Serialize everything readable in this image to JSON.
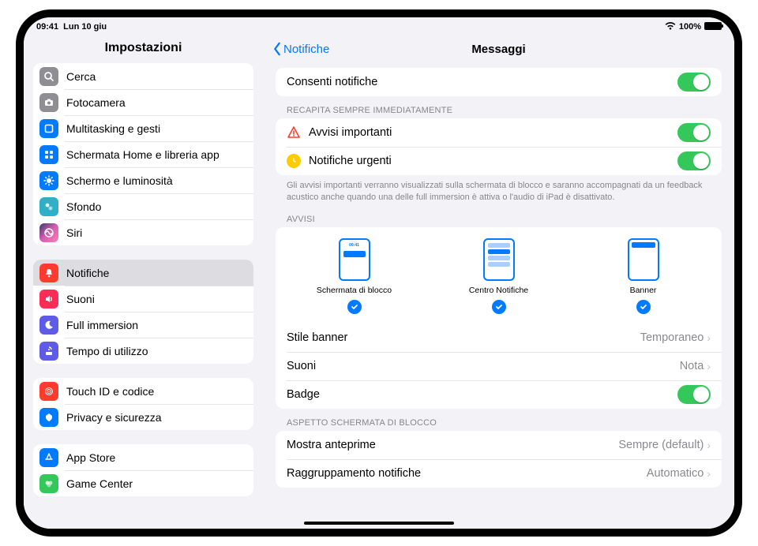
{
  "status": {
    "time": "09:41",
    "date": "Lun 10 giu",
    "battery": "100%"
  },
  "sidebar": {
    "title": "Impostazioni",
    "groups": [
      [
        {
          "label": "Cerca",
          "iconBg": "bg-gray"
        },
        {
          "label": "Fotocamera",
          "iconBg": "bg-gray"
        },
        {
          "label": "Multitasking e gesti",
          "iconBg": "bg-blue"
        },
        {
          "label": "Schermata Home e libreria app",
          "iconBg": "bg-blue"
        },
        {
          "label": "Schermo e luminosità",
          "iconBg": "bg-blue"
        },
        {
          "label": "Sfondo",
          "iconBg": "bg-teal"
        },
        {
          "label": "Siri",
          "iconBg": "bg-black"
        }
      ],
      [
        {
          "label": "Notifiche",
          "iconBg": "bg-red",
          "selected": true
        },
        {
          "label": "Suoni",
          "iconBg": "bg-pink"
        },
        {
          "label": "Full immersion",
          "iconBg": "bg-indigo"
        },
        {
          "label": "Tempo di utilizzo",
          "iconBg": "bg-indigo"
        }
      ],
      [
        {
          "label": "Touch ID e codice",
          "iconBg": "bg-red"
        },
        {
          "label": "Privacy e sicurezza",
          "iconBg": "bg-blue"
        }
      ],
      [
        {
          "label": "App Store",
          "iconBg": "bg-blue"
        },
        {
          "label": "Game Center",
          "iconBg": "bg-green"
        }
      ]
    ]
  },
  "detail": {
    "back": "Notifiche",
    "title": "Messaggi",
    "allow_label": "Consenti notifiche",
    "deliver_header": "RECAPITA SEMPRE IMMEDIATAMENTE",
    "critical_label": "Avvisi importanti",
    "time_sensitive_label": "Notifiche urgenti",
    "footer_immediate": "Gli avvisi importanti verranno visualizzati sulla schermata di blocco e saranno accompagnati da un feedback acustico anche quando una delle full immersion è attiva o l'audio di iPad è disattivato.",
    "alerts_header": "AVVISI",
    "preview_lock": "Schermata di blocco",
    "preview_lock_time": "09:41",
    "preview_center": "Centro Notifiche",
    "preview_banner": "Banner",
    "banner_style_label": "Stile banner",
    "banner_style_value": "Temporaneo",
    "sounds_label": "Suoni",
    "sounds_value": "Nota",
    "badge_label": "Badge",
    "lockscreen_header": "ASPETTO SCHERMATA DI BLOCCO",
    "show_previews_label": "Mostra anteprime",
    "show_previews_value": "Sempre (default)",
    "grouping_label": "Raggruppamento notifiche",
    "grouping_value": "Automatico"
  }
}
